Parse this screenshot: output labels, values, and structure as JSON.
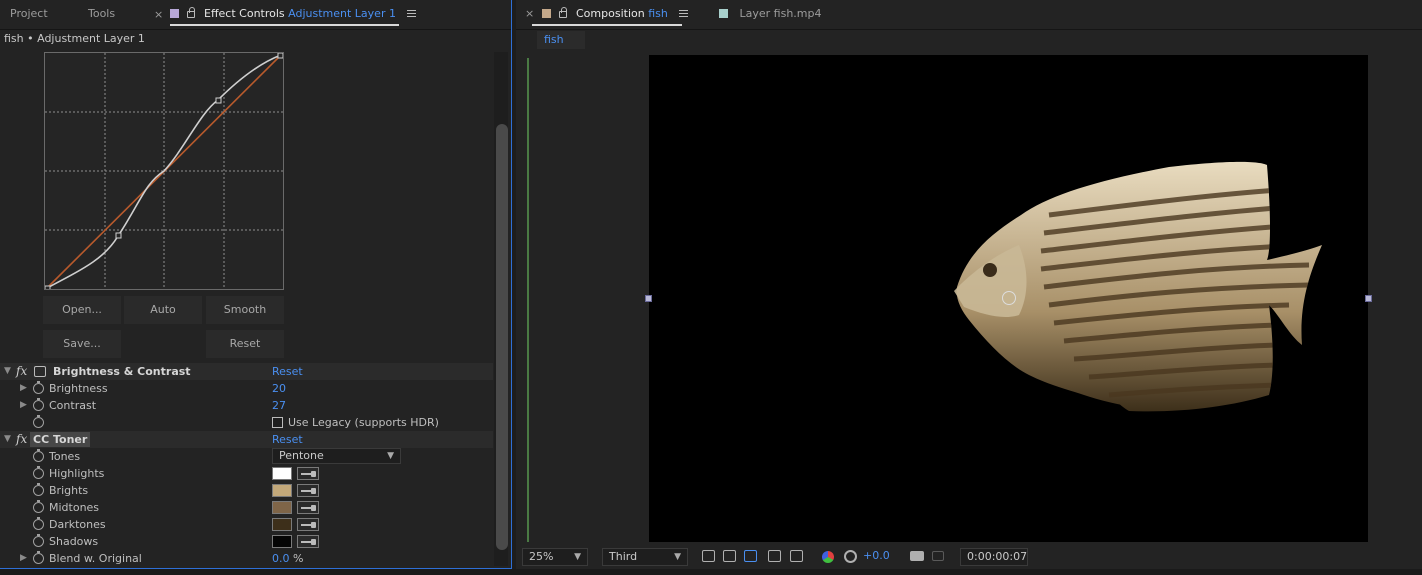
{
  "left_tabs": {
    "project": "Project",
    "tools": "Tools",
    "close": "×",
    "effect_controls": "Effect Controls",
    "effect_layer": "Adjustment Layer 1"
  },
  "breadcrumb": "fish • Adjustment Layer 1",
  "curve_buttons": {
    "open": "Open...",
    "auto": "Auto",
    "smooth": "Smooth",
    "save": "Save...",
    "reset": "Reset"
  },
  "brightness_contrast": {
    "name": "Brightness & Contrast",
    "reset": "Reset",
    "brightness_label": "Brightness",
    "brightness_value": "20",
    "contrast_label": "Contrast",
    "contrast_value": "27",
    "legacy_label": "Use Legacy (supports HDR)"
  },
  "cc_toner": {
    "name": "CC Toner",
    "reset": "Reset",
    "tones_label": "Tones",
    "tones_value": "Pentone",
    "highlights_label": "Highlights",
    "highlights_color": "#ffffff",
    "brights_label": "Brights",
    "brights_color": "#c2a87a",
    "midtones_label": "Midtones",
    "midtones_color": "#7f6548",
    "darktones_label": "Darktones",
    "darktones_color": "#3d2f1a",
    "shadows_label": "Shadows",
    "shadows_color": "#050505",
    "blend_label": "Blend w. Original",
    "blend_value": "0.0",
    "blend_unit": "%"
  },
  "comp_tabs": {
    "composition_prefix": "Composition",
    "composition_name": "fish",
    "layer_tab": "Layer  fish.mp4",
    "subtab": "fish"
  },
  "viewer_bar": {
    "zoom": "25%",
    "view": "Third",
    "exposure": "+0.0",
    "timecode": "0:00:00:07"
  },
  "colors": {
    "accent": "#4a8ff0",
    "panel_bg": "#232323"
  }
}
